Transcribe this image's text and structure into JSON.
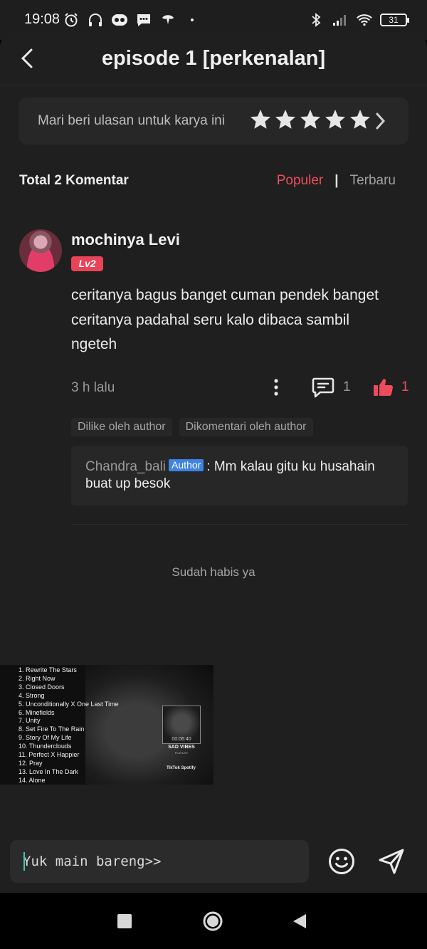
{
  "status_bar": {
    "time": "19:08",
    "battery": "31",
    "left_icons": [
      "alarm-icon",
      "headphones-icon",
      "game-icon",
      "message-icon",
      "gesture-icon",
      "dot-icon"
    ],
    "right_icons": [
      "bluetooth-icon",
      "signal-icon",
      "wifi-icon",
      "battery-icon"
    ]
  },
  "header": {
    "title": "episode 1 [perkenalan]",
    "back_icon": "chevron-left-icon"
  },
  "rating": {
    "prompt": "Mari beri ulasan untuk karya ini",
    "stars": 5,
    "star_color": "#e6e6e6"
  },
  "comments_header": {
    "total": "Total 2 Komentar",
    "sort_popular": "Populer",
    "separator": "|",
    "sort_latest": "Terbaru"
  },
  "comment": {
    "user": "mochinya Levi",
    "level": "Lv2",
    "text": "ceritanya bagus banget cuman pendek banget ceritanya padahal seru kalo dibaca sambil ngeteh",
    "time": "3 h lalu",
    "reply_count": "1",
    "like_count": "1",
    "tags": [
      "Dilike oleh author",
      "Dikomentari oleh author"
    ],
    "reply": {
      "author": "Chandra_bali",
      "badge": "Author",
      "text": ": Mm kalau gitu ku husahain buat up besok"
    }
  },
  "end_message": "Sudah habis ya",
  "media_card": {
    "tracks": [
      "1. Rewrite The Stars",
      "2. Right Now",
      "3. Closed Doors",
      "4. Strong",
      "5. Unconditionally X One Last Time",
      "6. Minefields",
      "7. Unity",
      "8. Set Fire To The Rain",
      "9. Story Of My Life",
      "10. Thunderclouds",
      "11. Perfect X Happier",
      "12. Pray",
      "13. Love In The Dark",
      "14. Alone"
    ],
    "time": "00:06:40",
    "title": "SAD VIBES",
    "subtitle": "PLAYLIST",
    "brands": "TikTok Spotify"
  },
  "composer": {
    "placeholder": "Yuk main bareng>>",
    "caret_color": "#3fc7b2"
  },
  "colors": {
    "accent": "#ef4b5f",
    "badge_blue": "#3d83e3",
    "background": "#1f1f1f"
  }
}
